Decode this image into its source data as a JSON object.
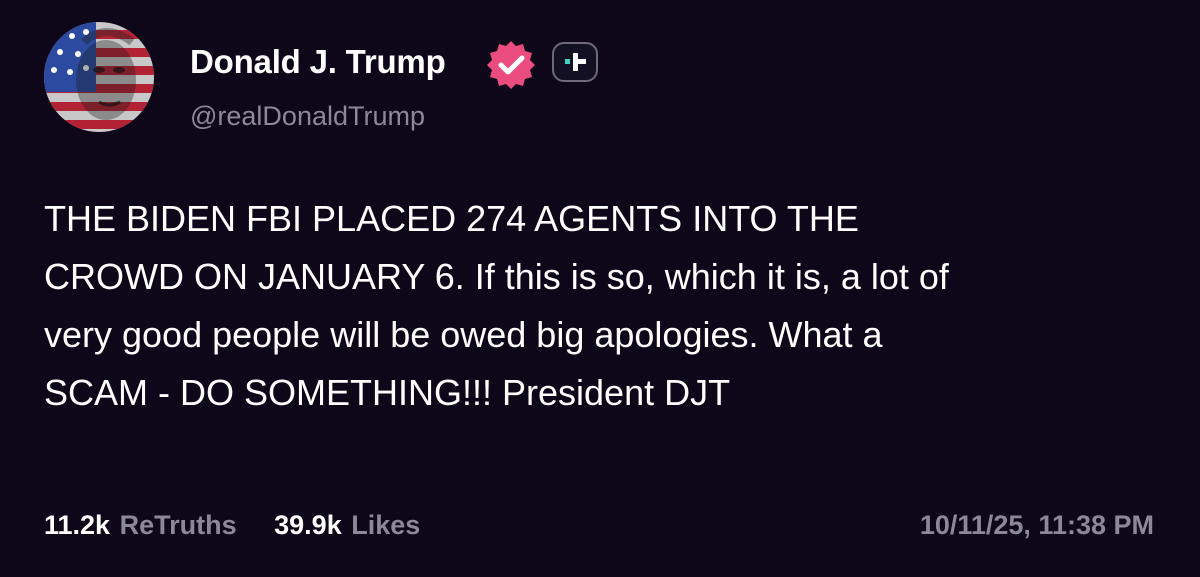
{
  "post": {
    "author": {
      "display_name": "Donald J. Trump",
      "handle": "@realDonaldTrump",
      "verified": true,
      "avatar_icon": "flag-portrait-avatar"
    },
    "text": "THE BIDEN FBI PLACED 274 AGENTS INTO THE\nCROWD ON JANUARY 6. If this is so, which it is, a lot of\nvery good people will be owed big apologies. What a\nSCAM - DO SOMETHING!!! President DJT",
    "stats": {
      "retruths_count": "11.2k",
      "retruths_label": "ReTruths",
      "likes_count": "39.9k",
      "likes_label": "Likes"
    },
    "timestamp": "10/11/25, 11:38 PM"
  },
  "colors": {
    "background": "#0d0719",
    "text_primary": "#ffffff",
    "text_secondary": "#8b889a",
    "verified_badge": "#ea4c7d",
    "plus_accent": "#3ed6c0"
  }
}
